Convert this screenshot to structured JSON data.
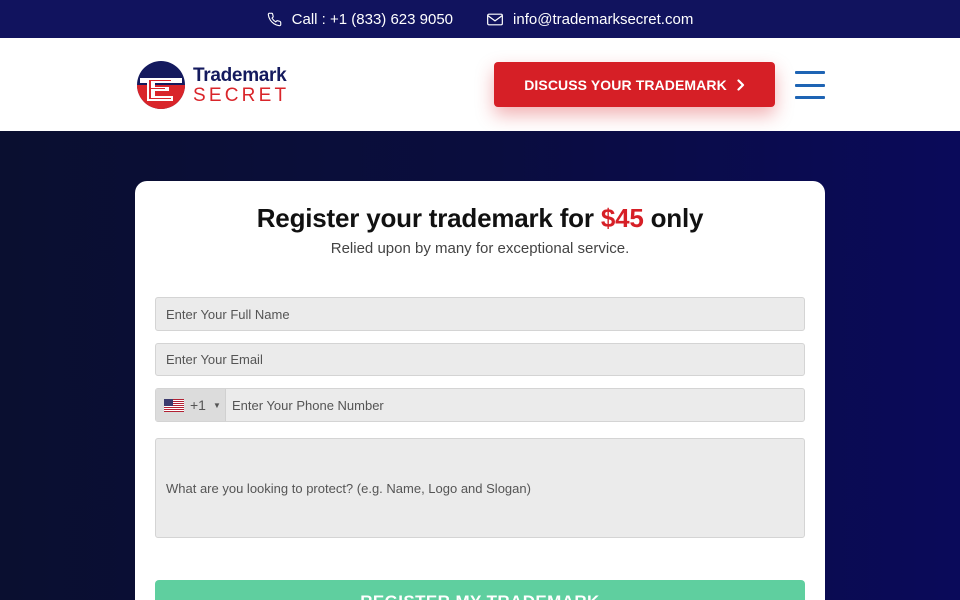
{
  "topbar": {
    "phone": "Call : +1 (833) 623 9050",
    "email": "info@trademarksecret.com"
  },
  "brand": {
    "line1": "Trademark",
    "line2": "SECRET",
    "colors": {
      "navy": "#141a5e",
      "red": "#d9252a"
    }
  },
  "header": {
    "cta_label": "DISCUSS YOUR TRADEMARK",
    "cta_icon": "chevron-right-icon",
    "menu_icon": "hamburger-menu-icon"
  },
  "form": {
    "title_before": "Register your trademark for ",
    "title_price": "$45",
    "title_after": " only",
    "subtitle": "Relied upon by many for exceptional service.",
    "name_placeholder": "Enter Your Full Name",
    "email_placeholder": "Enter Your Email",
    "phone_country": "United States",
    "phone_dial": "+1",
    "phone_placeholder": "Enter Your Phone Number",
    "message_placeholder": "What are you looking to protect? (e.g. Name, Logo and Slogan)",
    "submit_label": "REGISTER MY TRADEMARK"
  },
  "colors": {
    "topbar_bg": "#11135e",
    "accent_red": "#d61f26",
    "submit_green": "#5fcf9f",
    "menu_blue": "#1e64b4"
  }
}
